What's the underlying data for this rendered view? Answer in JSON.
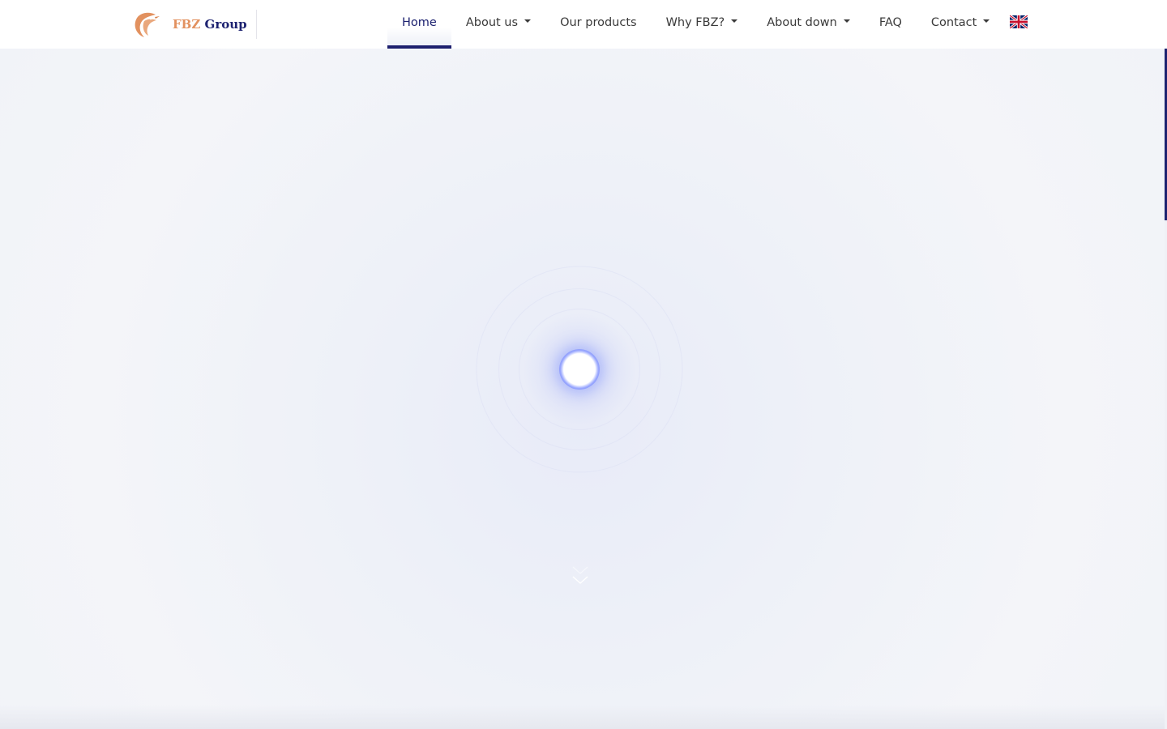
{
  "brand": {
    "name_accent": "FBZ",
    "name_main": "Group",
    "logo_icon": "bird-logo-icon",
    "accent_color": "#e2915f",
    "main_color": "#1d2270"
  },
  "nav": {
    "items": [
      {
        "label": "Home",
        "active": true,
        "dropdown": false
      },
      {
        "label": "About us",
        "active": false,
        "dropdown": true
      },
      {
        "label": "Our products",
        "active": false,
        "dropdown": false
      },
      {
        "label": "Why FBZ?",
        "active": false,
        "dropdown": true
      },
      {
        "label": "About down",
        "active": false,
        "dropdown": true
      },
      {
        "label": "FAQ",
        "active": false,
        "dropdown": false
      },
      {
        "label": "Contact",
        "active": false,
        "dropdown": true
      }
    ],
    "language_icon": "uk-flag-icon",
    "active_color": "#1d1f6e"
  },
  "hero": {
    "loader_icon": "loading-spinner-icon",
    "scroll_icon": "chevron-down-icon"
  }
}
